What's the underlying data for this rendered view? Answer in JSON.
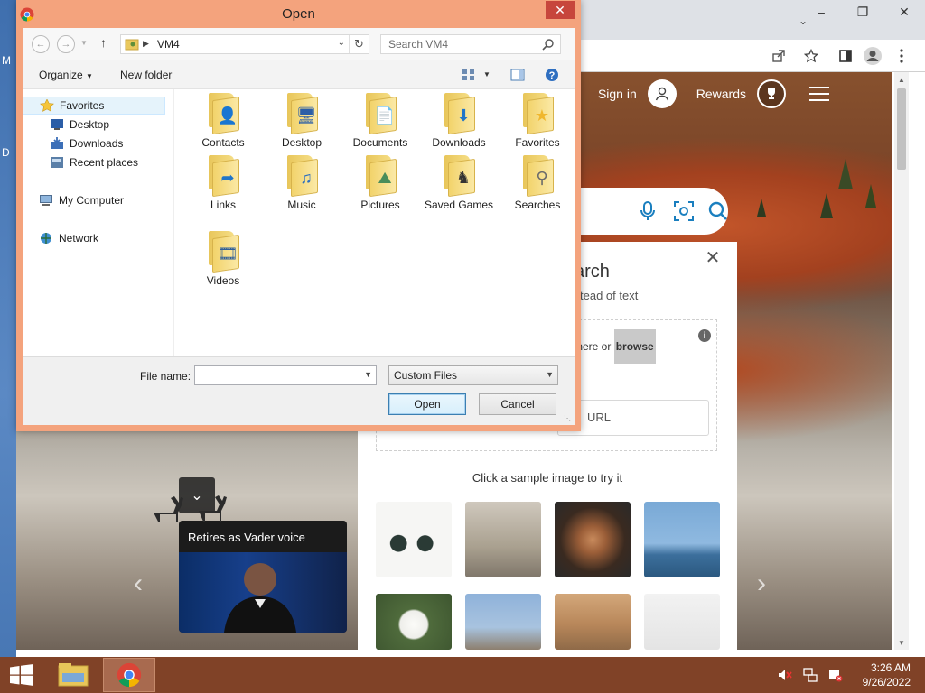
{
  "dialog": {
    "title": "Open",
    "address_path": "VM4",
    "search_placeholder": "Search VM4",
    "toolbar": {
      "organize": "Organize",
      "new_folder": "New folder"
    },
    "nav": [
      {
        "label": "Favorites",
        "icon": "star-icon"
      },
      {
        "label": "Desktop",
        "icon": "desktop-icon"
      },
      {
        "label": "Downloads",
        "icon": "downloads-icon"
      },
      {
        "label": "Recent places",
        "icon": "recent-places-icon"
      },
      {
        "label": "My Computer",
        "icon": "computer-icon"
      },
      {
        "label": "Network",
        "icon": "network-icon"
      }
    ],
    "files": [
      {
        "label": "Contacts",
        "icon": "contacts-icon"
      },
      {
        "label": "Desktop",
        "icon": "desktop-icon"
      },
      {
        "label": "Documents",
        "icon": "documents-icon"
      },
      {
        "label": "Downloads",
        "icon": "downloads-icon"
      },
      {
        "label": "Favorites",
        "icon": "star-icon"
      },
      {
        "label": "Links",
        "icon": "links-icon"
      },
      {
        "label": "Music",
        "icon": "music-icon"
      },
      {
        "label": "Pictures",
        "icon": "pictures-icon"
      },
      {
        "label": "Saved Games",
        "icon": "saved-games-icon"
      },
      {
        "label": "Searches",
        "icon": "magnifier-icon"
      },
      {
        "label": "Videos",
        "icon": "videos-icon"
      }
    ],
    "file_name_label": "File name:",
    "file_name_value": "",
    "filter_value": "Custom Files",
    "open_button": "Open",
    "cancel_button": "Cancel"
  },
  "bing": {
    "sign_in": "Sign in",
    "rewards": "Rewards",
    "panel_title_visible": "arch",
    "panel_subtitle_visible": "tead of text",
    "drop_text_visible": "s here or",
    "browse": "browse",
    "url_visible": "URL",
    "sample_prompt": "Click a sample image to try it",
    "news_headline": "Retires as Vader voice"
  },
  "desktop_visible_chars": [
    "M",
    "D"
  ],
  "taskbar": {
    "time": "3:26 AM",
    "date": "9/26/2022"
  },
  "colors": {
    "dialog_frame": "#f4a37d",
    "close_red": "#c7463c",
    "taskbar": "#804227"
  }
}
